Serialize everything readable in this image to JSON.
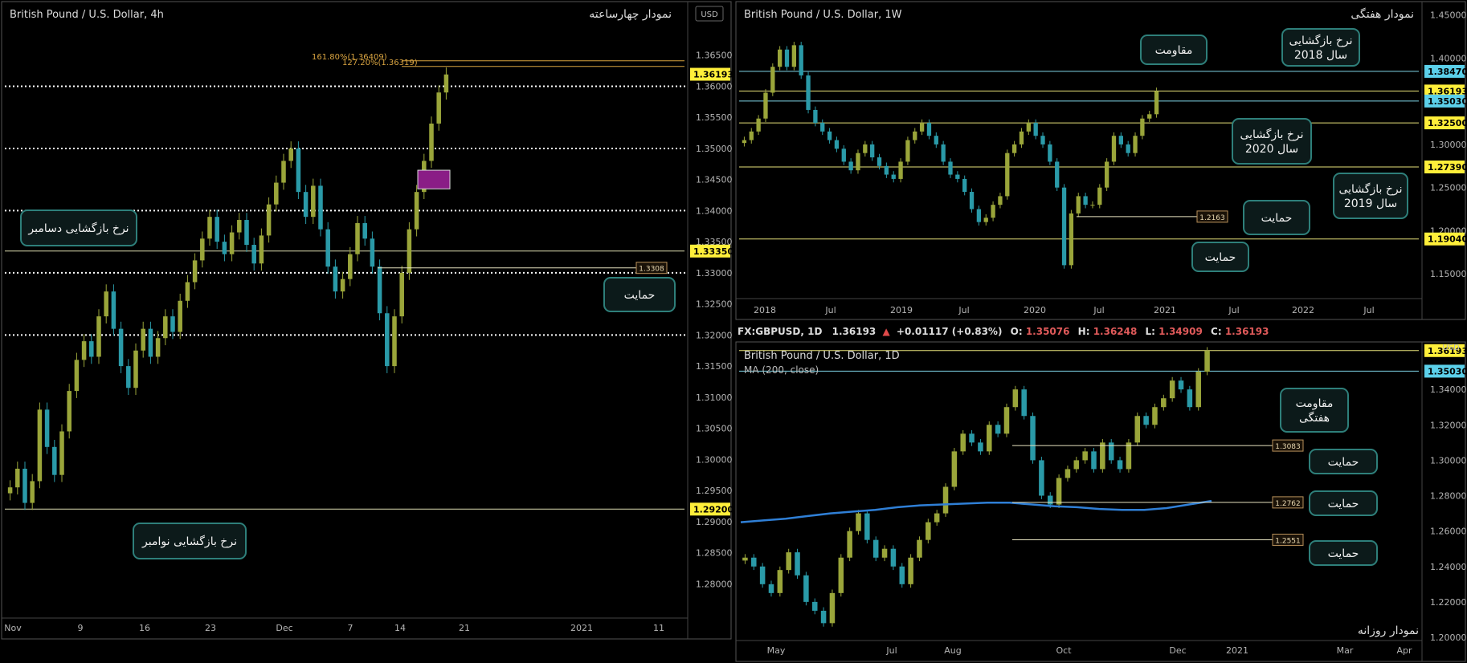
{
  "colors": {
    "up": "#9aa53a",
    "down": "#2a9aa8",
    "white_level": "#ffffff",
    "yellow_level": "#e8e27a",
    "cyan_level": "#7fd6e8",
    "fib": "#d9a441",
    "ma": "#2f7fd6",
    "callout_bg": "#0c1a1a",
    "callout_border": "#2e7f7a",
    "price_tag_yellow": "#ffef3a",
    "price_tag_blue": "#5bd0ea",
    "price_tag_brown": "#b8905a",
    "box_purple": "#8a1d86"
  },
  "symbol_bar": {
    "symbol": "FX:GBPUSD, 1D",
    "last": "1.36193",
    "arrow": "▲",
    "change": "+0.01117 (+0.83%)",
    "o_label": "O:",
    "o_val": "1.35076",
    "h_label": "H:",
    "h_val": "1.36248",
    "l_label": "L:",
    "l_val": "1.34909",
    "c_label": "C:",
    "c_val": "1.36193"
  },
  "chart_data": [
    {
      "id": "h4",
      "type": "candlestick",
      "title": "British Pound / U.S. Dollar, 4h",
      "persian_title": "نمودار چهارساعته",
      "currency_badge": "USD",
      "ylim": [
        1.275,
        1.37
      ],
      "y_ticks": [
        "1.36500",
        "1.36000",
        "1.35500",
        "1.35000",
        "1.34500",
        "1.34000",
        "1.33500",
        "1.33000",
        "1.32500",
        "1.32000",
        "1.31500",
        "1.31000",
        "1.30500",
        "1.30000",
        "1.29500",
        "1.29000",
        "1.28500",
        "1.28000"
      ],
      "x_ticks": [
        "Nov",
        "9",
        "16",
        "23",
        "Dec",
        "7",
        "14",
        "21",
        "2021",
        "11"
      ],
      "price_tags": [
        {
          "value": 1.36193,
          "label": "1.36193",
          "color": "yellow"
        },
        {
          "value": 1.3335,
          "label": "1.33350",
          "color": "yellow"
        },
        {
          "value": 1.292,
          "label": "1.29200",
          "color": "yellow"
        }
      ],
      "dotted_levels": [
        1.36,
        1.35,
        1.34,
        1.33,
        1.32
      ],
      "solid_levels": [
        1.3335,
        1.292
      ],
      "short_levels": [
        {
          "value": 1.3308,
          "label": "1.3308"
        }
      ],
      "fib_levels": [
        {
          "value": 1.36409,
          "label": "161.80%(1.36409)"
        },
        {
          "value": 1.36319,
          "label": "127.20%(1.36319)"
        }
      ],
      "annotations": [
        {
          "text": "نرخ بازگشایی دسامبر",
          "level": "december_open"
        },
        {
          "text": "حمایت",
          "level": "support"
        },
        {
          "text": "نرخ بازگشایی نوامبر",
          "level": "november_open"
        }
      ],
      "closes": [
        1.2955,
        1.2985,
        1.293,
        1.2965,
        1.308,
        1.302,
        1.2975,
        1.3045,
        1.311,
        1.316,
        1.319,
        1.3165,
        1.323,
        1.327,
        1.321,
        1.315,
        1.3115,
        1.3175,
        1.321,
        1.3165,
        1.3195,
        1.323,
        1.3205,
        1.3255,
        1.3285,
        1.332,
        1.3355,
        1.339,
        1.335,
        1.333,
        1.3365,
        1.3385,
        1.3345,
        1.3315,
        1.336,
        1.341,
        1.3445,
        1.348,
        1.35,
        1.343,
        1.339,
        1.344,
        1.337,
        1.331,
        1.327,
        1.329,
        1.333,
        1.338,
        1.3355,
        1.331,
        1.3235,
        1.315,
        1.323,
        1.33,
        1.337,
        1.343,
        1.348,
        1.354,
        1.359,
        1.3619
      ]
    },
    {
      "id": "w1",
      "type": "candlestick",
      "title": "British Pound / U.S. Dollar, 1W",
      "persian_title": "نمودار هفتگی",
      "ylim": [
        1.125,
        1.46
      ],
      "y_ticks": [
        "1.45000",
        "1.40000",
        "1.35000",
        "1.30000",
        "1.25000",
        "1.20000",
        "1.15000"
      ],
      "x_ticks": [
        "2018",
        "Jul",
        "2019",
        "Jul",
        "2020",
        "Jul",
        "2021",
        "Jul",
        "2022",
        "Jul"
      ],
      "price_tags": [
        {
          "value": 1.3847,
          "label": "1.38470",
          "color": "blue"
        },
        {
          "value": 1.36193,
          "label": "1.36193",
          "color": "yellow"
        },
        {
          "value": 1.3503,
          "label": "1.35030",
          "color": "blue"
        },
        {
          "value": 1.325,
          "label": "1.32500",
          "color": "yellow"
        },
        {
          "value": 1.2739,
          "label": "1.27390",
          "color": "yellow"
        },
        {
          "value": 1.1904,
          "label": "1.19040",
          "color": "yellow"
        }
      ],
      "short_levels": [
        {
          "value": 1.2163,
          "label": "1.2163"
        }
      ],
      "annotations": [
        {
          "text": "مقاومت"
        },
        {
          "text": "نرخ بازگشایی",
          "text2": "سال 2018"
        },
        {
          "text": "نرخ بازگشایی",
          "text2": "سال 2020"
        },
        {
          "text": "نرخ بازگشایی",
          "text2": "سال 2019"
        },
        {
          "text": "حمایت"
        },
        {
          "text": "حمایت"
        }
      ],
      "closes": [
        1.305,
        1.315,
        1.33,
        1.36,
        1.39,
        1.41,
        1.39,
        1.415,
        1.38,
        1.34,
        1.325,
        1.315,
        1.305,
        1.295,
        1.28,
        1.27,
        1.29,
        1.3,
        1.285,
        1.275,
        1.265,
        1.26,
        1.28,
        1.305,
        1.315,
        1.325,
        1.31,
        1.3,
        1.28,
        1.265,
        1.26,
        1.245,
        1.225,
        1.21,
        1.215,
        1.23,
        1.24,
        1.29,
        1.3,
        1.315,
        1.325,
        1.31,
        1.3,
        1.28,
        1.25,
        1.16,
        1.22,
        1.24,
        1.23,
        1.23,
        1.25,
        1.28,
        1.31,
        1.3,
        1.29,
        1.31,
        1.33,
        1.335,
        1.3619
      ]
    },
    {
      "id": "d1",
      "type": "candlestick",
      "title": "British Pound / U.S. Dollar, 1D",
      "ma_label": "MA (200, close)",
      "persian_title": "نمودار روزانه",
      "currency_badge": "USD",
      "ylim": [
        1.2,
        1.365
      ],
      "y_ticks": [
        "1.34000",
        "1.32000",
        "1.30000",
        "1.28000",
        "1.26000",
        "1.24000",
        "1.22000",
        "1.20000"
      ],
      "x_ticks": [
        "May",
        "Jul",
        "Aug",
        "Oct",
        "Dec",
        "2021",
        "Mar",
        "Apr"
      ],
      "price_tags": [
        {
          "value": 1.36193,
          "label": "1.36193",
          "color": "yellow"
        },
        {
          "value": 1.3503,
          "label": "1.35030",
          "color": "blue"
        }
      ],
      "short_levels": [
        {
          "value": 1.3083,
          "label": "1.3083"
        },
        {
          "value": 1.2762,
          "label": "1.2762"
        },
        {
          "value": 1.2551,
          "label": "1.2551"
        }
      ],
      "annotations": [
        {
          "text": "مقاومت",
          "text2": "هفتگی"
        },
        {
          "text": "حمایت"
        },
        {
          "text": "حمایت"
        },
        {
          "text": "حمایت"
        }
      ],
      "closes": [
        1.245,
        1.24,
        1.23,
        1.225,
        1.238,
        1.248,
        1.235,
        1.22,
        1.215,
        1.208,
        1.225,
        1.245,
        1.26,
        1.27,
        1.255,
        1.245,
        1.25,
        1.24,
        1.23,
        1.245,
        1.255,
        1.265,
        1.27,
        1.285,
        1.305,
        1.315,
        1.31,
        1.305,
        1.32,
        1.315,
        1.33,
        1.34,
        1.325,
        1.3,
        1.28,
        1.275,
        1.29,
        1.295,
        1.3,
        1.305,
        1.295,
        1.31,
        1.3,
        1.295,
        1.31,
        1.325,
        1.32,
        1.33,
        1.335,
        1.345,
        1.34,
        1.33,
        1.35,
        1.3619
      ],
      "ma_series": [
        1.265,
        1.266,
        1.267,
        1.2685,
        1.27,
        1.271,
        1.272,
        1.2735,
        1.2745,
        1.275,
        1.2755,
        1.276,
        1.276,
        1.275,
        1.274,
        1.2735,
        1.2725,
        1.272,
        1.272,
        1.273,
        1.275,
        1.277
      ]
    }
  ]
}
